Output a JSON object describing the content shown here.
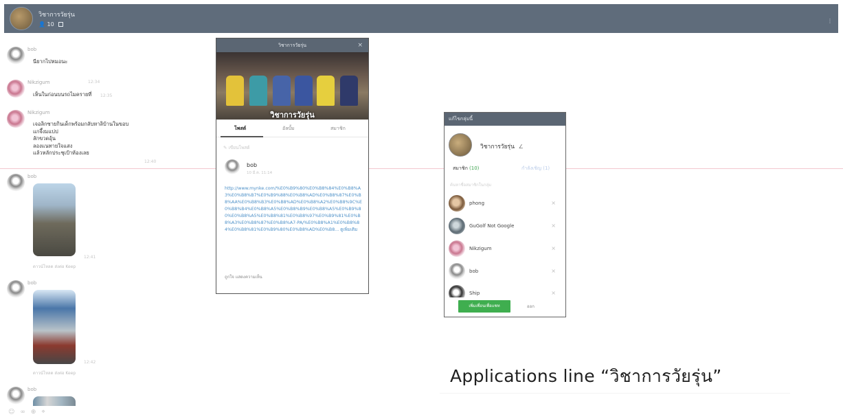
{
  "header": {
    "group_name": "วิชาการวัยรุ่น",
    "member_count": "10"
  },
  "chat": {
    "messages": [
      {
        "sender": "bob",
        "text": "นียากไปหมอนะ",
        "time": "12:34"
      },
      {
        "sender": "Nikzigum",
        "text": "เห็นในก่อนบนรถไมครายที่",
        "time": "12:35"
      },
      {
        "sender": "Nikzigum",
        "lines": [
          "เจอลิกซายกินเด็กพร้อมกลับหาลิบ้านในขอบ",
          "แกจึ้งมแบ่ป",
          "ลักขวดอุ้น",
          "ลองแนทายใจแสง",
          "แล้วหลักประชุเป้าห้องเลย"
        ],
        "time": "12:40"
      },
      {
        "sender": "bob",
        "time": "12:41"
      },
      {
        "sender": "bob",
        "time": "12:42"
      },
      {
        "sender": "bob"
      }
    ],
    "photo_actions": "ดาวน์โหลด  ส่งต่อ  Keep"
  },
  "post_popup": {
    "title": "วิชาการวัยรุ่น",
    "cover_title": "วิชาการวัยรุ่น",
    "tabs": [
      "โพสต์",
      "อัลบั้ม",
      "สมาชิก"
    ],
    "write_placeholder": "เขียนโพสต์",
    "post": {
      "author": "bob",
      "date": "10 มี.ค. 11:14",
      "link": "http://www.mynke.com/%E0%B9%80%E0%B8%84%E0%B8%A3%E0%B8%B7%E0%B9%88%E0%B8%AD%E0%B8%87%E0%B8%AA%E0%B8%B3%E0%B8%AD%E0%B8%A2%E0%B8%9C%E0%B8%B4%E0%B8%A5%E0%B8%B9%E0%B8%A5%E0%B9%80%E0%B8%A5%E0%B8%81%E0%B8%97%E0%B9%81%E0%B8%A3%E0%B8%87%E0%B8%A7-PA/%E0%B8%A1%E0%B8%84%E0%B8%81%E0%B9%80%E0%B8%AD%E0%B8...",
      "more": "ดูเพิ่มเติม",
      "footer": "ถูกใจ   แสดงความเห็น"
    }
  },
  "member_panel": {
    "title": "แก้ไขกลุ่มนี้",
    "group_name": "วิชาการวัยรุ่น",
    "tab_members_label": "สมาชิก",
    "tab_members_count": "(10)",
    "tab_invited": "กำลังเชิญ (1)",
    "search_placeholder": "ค้นหาชื่อสมาชิกในกลุ่ม",
    "members": [
      {
        "name": "phong"
      },
      {
        "name": "GuGolf Not Google"
      },
      {
        "name": "Nikzigum"
      },
      {
        "name": "bob"
      },
      {
        "name": "Ship"
      }
    ],
    "add_button": "เพิ่มเพื่อนเพื่อแชท",
    "other_button": "ออก"
  },
  "caption": "Applications line “วิชาการวัยรุ่น”",
  "bottom_icons": [
    "smile-icon",
    "attach-icon",
    "add-icon",
    "crop-icon"
  ]
}
